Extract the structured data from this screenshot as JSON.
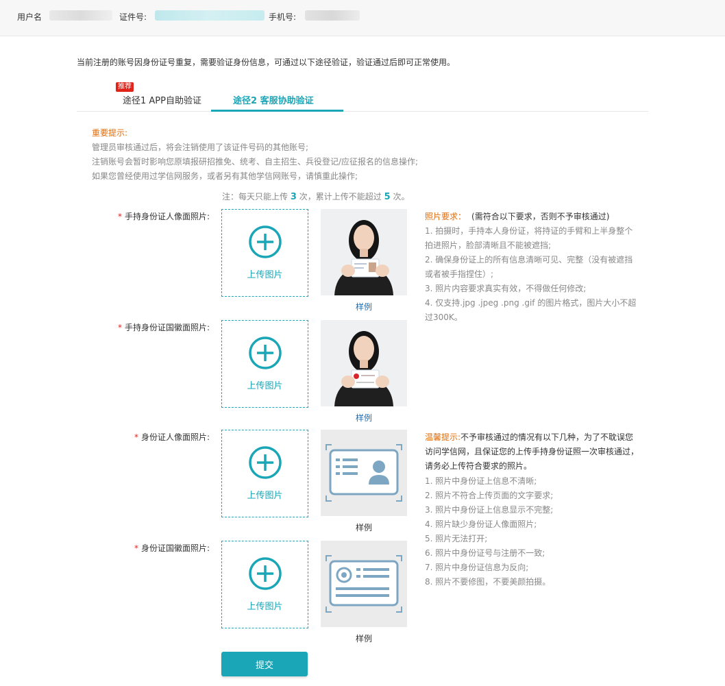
{
  "header": {
    "username_label": "用户名",
    "id_label": "证件号:",
    "phone_label": "手机号:"
  },
  "notice": "当前注册的账号因身份证号重复，需要验证身份信息，可通过以下途径验证，验证通过后即可正常使用。",
  "tabs": [
    {
      "label": "途径1 APP自助验证",
      "badge": "推荐"
    },
    {
      "label": "途径2 客服协助验证"
    }
  ],
  "tips": {
    "title": "重要提示:",
    "lines": [
      "管理员审核通过后，将会注销使用了该证件号码的其他账号;",
      "注销账号会暂时影响您原填报研招推免、统考、自主招生、兵役登记/应征报名的信息操作;",
      "如果您曾经使用过学信网服务，或者另有其他学信网账号，请慎重此操作;"
    ]
  },
  "note": {
    "prefix": "注：每天只能上传",
    "daily": "3",
    "mid": "次，累计上传不能超过",
    "total": "5",
    "suffix": "次。"
  },
  "uploads": [
    {
      "label": "手持身份证人像面照片:",
      "upload_text": "上传图片",
      "sample_caption": "样例"
    },
    {
      "label": "手持身份证国徽面照片:",
      "upload_text": "上传图片",
      "sample_caption": "样例"
    },
    {
      "label": "身份证人像面照片:",
      "upload_text": "上传图片",
      "sample_caption": "样例"
    },
    {
      "label": "身份证国徽面照片:",
      "upload_text": "上传图片",
      "sample_caption": "样例"
    }
  ],
  "photo_requirements": {
    "title": "照片要求：",
    "subtitle": "(需符合以下要求，否则不予审核通过)",
    "items": [
      "1. 拍摄时，手持本人身份证，将持证的手臂和上半身整个拍进照片，脸部清晰且不能被遮挡;",
      "2. 确保身份证上的所有信息清晰可见、完整（没有被遮挡或者被手指捏住）;",
      "3. 照片内容要求真实有效，不得做任何修改;",
      "4. 仅支持.jpg .jpeg .png .gif 的图片格式，图片大小不超过300K。"
    ]
  },
  "warm_tips": {
    "title": "温馨提示:",
    "intro": "不予审核通过的情况有以下几种，为了不耽误您访问学信网，且保证您的上传手持身份证照一次审核通过，请务必上传符合要求的照片。",
    "items": [
      "1. 照片中身份证上信息不清晰;",
      "2. 照片不符合上传页面的文字要求;",
      "3. 照片中身份证上信息显示不完整;",
      "4. 照片缺少身份证人像面照片;",
      "5. 照片无法打开;",
      "6. 照片中身份证号与注册不一致;",
      "7. 照片中身份证信息为反向;",
      "8. 照片不要修图，不要美颜拍摄。"
    ]
  },
  "submit_label": "提交",
  "colors": {
    "accent": "#1aa6b7",
    "warning": "#e36c0a",
    "required": "#e2231a",
    "link": "#1a6fb7"
  }
}
